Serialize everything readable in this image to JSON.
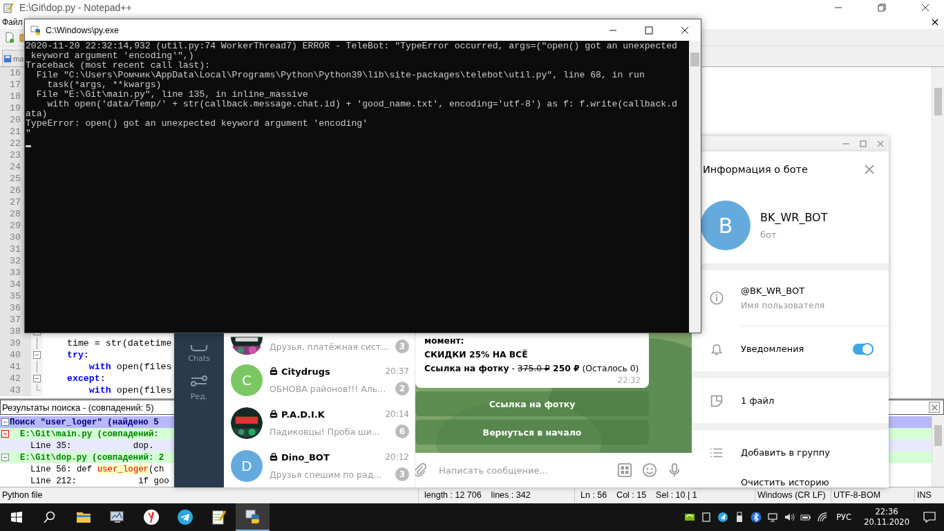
{
  "notepad": {
    "title": "E:\\Git\\dop.py - Notepad++",
    "menu": [
      "Файл"
    ],
    "tab": "ma",
    "lines": [
      {
        "number": "16",
        "kind": "plain"
      },
      {
        "number": "17",
        "kind": "plain"
      },
      {
        "number": "18",
        "kind": "plain"
      },
      {
        "number": "19",
        "kind": "plain"
      },
      {
        "number": "20",
        "kind": "plain"
      },
      {
        "number": "21",
        "kind": "plain"
      },
      {
        "number": "22",
        "kind": "plain"
      },
      {
        "number": "23",
        "kind": "plain"
      },
      {
        "number": "24",
        "kind": "plain"
      },
      {
        "number": "25",
        "kind": "plain"
      },
      {
        "number": "26",
        "kind": "plain"
      },
      {
        "number": "27",
        "kind": "plain"
      },
      {
        "number": "28",
        "kind": "plain"
      },
      {
        "number": "29",
        "kind": "plain"
      },
      {
        "number": "30",
        "kind": "plain"
      },
      {
        "number": "31",
        "kind": "plain"
      },
      {
        "number": "32",
        "kind": "plain"
      },
      {
        "number": "33",
        "kind": "plain"
      },
      {
        "number": "34",
        "kind": "plain"
      },
      {
        "number": "35",
        "kind": "plain"
      },
      {
        "number": "36",
        "kind": "plain"
      },
      {
        "number": "37",
        "kind": "plain"
      },
      {
        "number": "38",
        "kind": "fold_start"
      },
      {
        "number": "39",
        "kind": "fold_body",
        "tokens": [
          {
            "text": "    time = str(datetime",
            "kind": "plain"
          }
        ]
      },
      {
        "number": "40",
        "kind": "fold_start",
        "tokens": [
          {
            "text": "    try",
            "kind": "keyword"
          },
          {
            "text": ":",
            "kind": "operator"
          }
        ]
      },
      {
        "number": "41",
        "kind": "fold_body",
        "tokens": [
          {
            "text": "        with",
            "kind": "keyword"
          },
          {
            "text": " open(files",
            "kind": "plain"
          }
        ]
      },
      {
        "number": "42",
        "kind": "fold_start",
        "tokens": [
          {
            "text": "    except",
            "kind": "keyword"
          },
          {
            "text": ":",
            "kind": "operator"
          }
        ]
      },
      {
        "number": "43",
        "kind": "fold_end",
        "tokens": [
          {
            "text": "        with",
            "kind": "keyword"
          },
          {
            "text": " open(files",
            "kind": "plain"
          }
        ]
      }
    ],
    "search": {
      "title": "Результаты поиска - (совпадений: 5)",
      "rows": [
        {
          "kind": "query",
          "selected": false,
          "parts": [
            {
              "text": "Поиск \"user_loger\" (найдено 5",
              "kind": "plain"
            }
          ]
        },
        {
          "kind": "file",
          "selected": false,
          "parts": [
            {
              "text": "E:\\Git\\main.py (совпадений:",
              "kind": "plain"
            }
          ]
        },
        {
          "kind": "hit",
          "selected": true,
          "parts": [
            {
              "text": "Line 35:            dop.",
              "kind": "plain"
            }
          ]
        },
        {
          "kind": "file",
          "selected": false,
          "parts": [
            {
              "text": "E:\\Git\\dop.py (совпадений: 2",
              "kind": "plain"
            }
          ]
        },
        {
          "kind": "hit",
          "selected": false,
          "parts": [
            {
              "text": "Line 56: def ",
              "kind": "plain"
            },
            {
              "text": "user_loger",
              "kind": "match"
            },
            {
              "text": "(ch",
              "kind": "plain"
            }
          ]
        },
        {
          "kind": "hit",
          "selected": false,
          "parts": [
            {
              "text": "Line 212:            if goo",
              "kind": "plain"
            }
          ]
        }
      ]
    },
    "status_bar": [
      "Python file",
      "length : 12 706    lines : 342",
      "Ln : 56    Col : 15    Sel : 10 | 1",
      "Windows (CR LF)",
      "UTF-8-BOM",
      "INS"
    ]
  },
  "console": {
    "title": "C:\\Windows\\py.exe",
    "lines": [
      "2020-11-20 22:32:14,932 (util.py:74 WorkerThread7) ERROR - TeleBot: \"TypeError occurred, args=(\"open() got an unexpected",
      " keyword argument 'encoding'\",)",
      "Traceback (most recent call last):",
      "  File \"C:\\Users\\Ромчик\\AppData\\Local\\Programs\\Python\\Python39\\lib\\site-packages\\telebot\\util.py\", line 68, in run",
      "    task(*args, **kwargs)",
      "  File \"E:\\Git\\main.py\", line 135, in inline_massive",
      "    with open('data/Temp/' + str(callback.message.chat.id) + 'good_name.txt', encoding='utf-8') as f: f.write(callback.d",
      "ata)",
      "TypeError: open() got an unexpected keyword argument 'encoding'",
      "\""
    ]
  },
  "telegram": {
    "sidebar": [
      {
        "kind": "chats",
        "label": "Chats"
      },
      {
        "kind": "settings",
        "label": "Ред."
      }
    ],
    "chats": [
      {
        "preview": "Друзья, платёжная сист...",
        "badge": "3"
      },
      {
        "avatar": {
          "kind": "letter",
          "letter": "C",
          "color": "#7bc862"
        },
        "name": "Citydrugs",
        "time": "20:37",
        "preview": "ОБНОВА районов!!! Аль...",
        "badge": "2"
      },
      {
        "name": "P.A.D.I.K",
        "time": "20:14",
        "preview": "Падиковцы! Проба ши...",
        "badge": "6"
      },
      {
        "avatar": {
          "kind": "letter",
          "letter": "D",
          "color": "#65aadd"
        },
        "name": "Dino_BOT",
        "time": "20:12",
        "preview": "Друзья спешим по рад...",
        "badge": "3"
      }
    ],
    "message": {
      "lines": [
        [
          {
            "text": "момент:",
            "kind": "bold"
          }
        ],
        [
          {
            "text": "СКИДКИ 25% НА ВСЁ",
            "kind": "bold"
          }
        ],
        [
          {
            "text": "Ссылка на фотку",
            "kind": "bold"
          },
          {
            "text": " - ",
            "kind": "plain"
          },
          {
            "text": "375.0 ₽",
            "kind": "strike"
          },
          {
            "text": " 250 ₽",
            "kind": "bold"
          },
          {
            "text": " (Осталось 0)",
            "kind": "plain"
          }
        ]
      ],
      "time": "22:32"
    },
    "buttons": [
      "Ссылка на фотку",
      "Вернуться в начало"
    ],
    "input": {
      "placeholder": "Написать сообщение..."
    },
    "info": {
      "title": "Информация о боте",
      "avatar": {
        "letter": "B",
        "color": "#65aadd"
      },
      "name": "BK_WR_BOT",
      "subtitle": "бот",
      "sections": [
        {
          "rows": [
            {
              "kind": "info",
              "value": "@BK_WR_BOT",
              "caption": "Имя пользователя"
            },
            {
              "kind": "toggle",
              "label": "Уведомления",
              "on": true
            }
          ]
        },
        {
          "rows": [
            {
              "kind": "files",
              "label": "1 файл"
            }
          ]
        },
        {
          "rows": [
            {
              "kind": "list",
              "label": "Добавить в группу"
            },
            {
              "kind": "plain",
              "label": "Очистить историю"
            }
          ]
        }
      ]
    }
  },
  "taskbar": {
    "apps": [
      {
        "kind": "folder",
        "selected": false
      },
      {
        "kind": "monitor",
        "selected": false
      },
      {
        "kind": "browser",
        "selected": false
      },
      {
        "kind": "telegram",
        "selected": false
      },
      {
        "kind": "notepad",
        "selected": false
      },
      {
        "kind": "python",
        "selected": true
      }
    ],
    "language": "РУС",
    "time": "22:36",
    "date": "20.11.2020"
  }
}
